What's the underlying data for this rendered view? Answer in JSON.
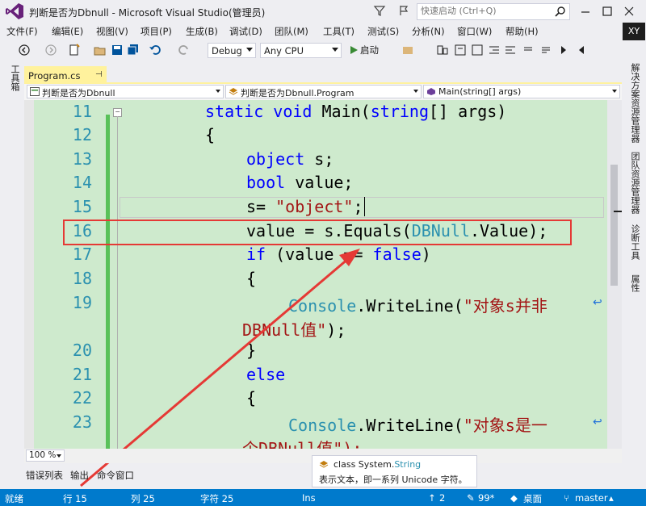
{
  "window": {
    "title": "判断是否为Dbnull - Microsoft Visual Studio(管理员)",
    "quick_launch_placeholder": "快速启动 (Ctrl+Q)",
    "avatar": "XY"
  },
  "menu": [
    "文件(F)",
    "编辑(E)",
    "视图(V)",
    "项目(P)",
    "生成(B)",
    "调试(D)",
    "团队(M)",
    "工具(T)",
    "测试(S)",
    "分析(N)",
    "窗口(W)",
    "帮助(H)"
  ],
  "toolbar": {
    "configuration": "Debug",
    "platform": "Any CPU",
    "start_label": "启动"
  },
  "left_tab": "工具箱",
  "right_tabs": [
    "解决方案资源管理器",
    "团队资源管理器",
    "诊断工具",
    "属性"
  ],
  "document_tab": {
    "label": "Program.cs",
    "pin": "⊣"
  },
  "navbar": {
    "project": "判断是否为Dbnull",
    "class": "判断是否为Dbnull.Program",
    "member": "Main(string[] args)"
  },
  "code": {
    "line_numbers": [
      "11",
      "12",
      "13",
      "14",
      "15",
      "16",
      "17",
      "18",
      "19",
      "20",
      "21",
      "22",
      "23"
    ],
    "lines": {
      "l11": {
        "kw1": "static",
        "kw2": "void",
        "rest1": "Main(",
        "kw3": "string",
        "rest2": "[] args)"
      },
      "l12": "{",
      "l13": {
        "kw": "object",
        "rest": " s;"
      },
      "l14": {
        "kw": "bool",
        "rest": " value;"
      },
      "l15": {
        "pre": "s= ",
        "str": "\"object\"",
        "post": ";"
      },
      "l16": {
        "pre": "value = s.Equals(",
        "typ": "DBNull",
        "post": ".Value);"
      },
      "l17": {
        "kw": "if",
        "mid": " (value == ",
        "kw2": "false",
        "post": ")"
      },
      "l18": "{",
      "l19": {
        "typ": "Console",
        "pre": ".WriteLine(",
        "str": "\"对象s并非"
      },
      "l19b": {
        "str": "DBNull值\"",
        "post": ");"
      },
      "l20": "}",
      "l21": {
        "kw": "else"
      },
      "l22": "{",
      "l23": {
        "typ": "Console",
        "pre": ".WriteLine(",
        "str": "\"对象s是一"
      },
      "l23b": {
        "str": "个DBNull值\");"
      }
    }
  },
  "zoom": "100 %",
  "bottom_tabs": [
    "错误列表",
    "输出",
    "命令窗口"
  ],
  "tooltip": {
    "prefix": "class System.",
    "type": "String",
    "description": "表示文本，即一系列 Unicode 字符。"
  },
  "status": {
    "ready": "就绪",
    "row": "行 15",
    "col": "列 25",
    "char": "字符 25",
    "ins": "Ins",
    "arrow_up_count": "2",
    "pencil_count": "99*",
    "repo": "桌面",
    "branch": "master"
  },
  "colors": {
    "accent": "#007ACC",
    "editor_bg": "#CEEACD",
    "highlight_box": "#E53935",
    "tab_active": "#FFF29D"
  }
}
